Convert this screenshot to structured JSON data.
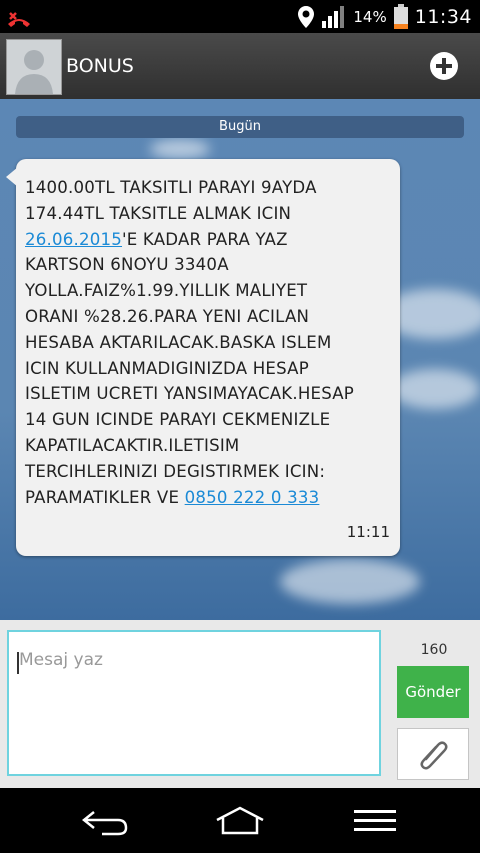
{
  "status_bar": {
    "battery_percent": "14%",
    "time": "11:34",
    "icons": [
      "missed-call-icon",
      "location-icon",
      "signal-icon",
      "battery-icon"
    ]
  },
  "header": {
    "contact_name": "BONUS"
  },
  "conversation": {
    "date_separator": "Bugün",
    "message": {
      "lines": [
        "1400.00TL TAKSITLI PARAYI 9AYDA",
        "174.44TL TAKSITLE ALMAK ICIN",
        "",
        "KARTSON 6NOYU 3340A",
        "YOLLA.FAIZ%1.99.YILLIK MALIYET",
        "ORANI %28.26.PARA YENI ACILAN",
        "HESABA AKTARILACAK.BASKA ISLEM",
        "ICIN KULLANMADIGINIZDA HESAP",
        "ISLETIM UCRETI YANSIMAYACAK.HESAP",
        "14 GUN ICINDE PARAYI CEKMENIZLE",
        "KAPATILACAKTIR.ILETISIM",
        "TERCIHLERINIZI DEGISTIRMEK ICIN:",
        ""
      ],
      "date_link": "26.06.2015",
      "date_line_suffix": "'E KADAR PARA YAZ",
      "last_line_prefix": "PARAMATIKLER VE ",
      "phone_link": "0850 222 0 333",
      "time": "11:11"
    }
  },
  "compose": {
    "placeholder": "Mesaj yaz",
    "char_counter": "160",
    "send_label": "Gönder"
  },
  "colors": {
    "send_button": "#3fb24a",
    "link": "#1b8ad6",
    "input_border": "#6fd3df"
  }
}
